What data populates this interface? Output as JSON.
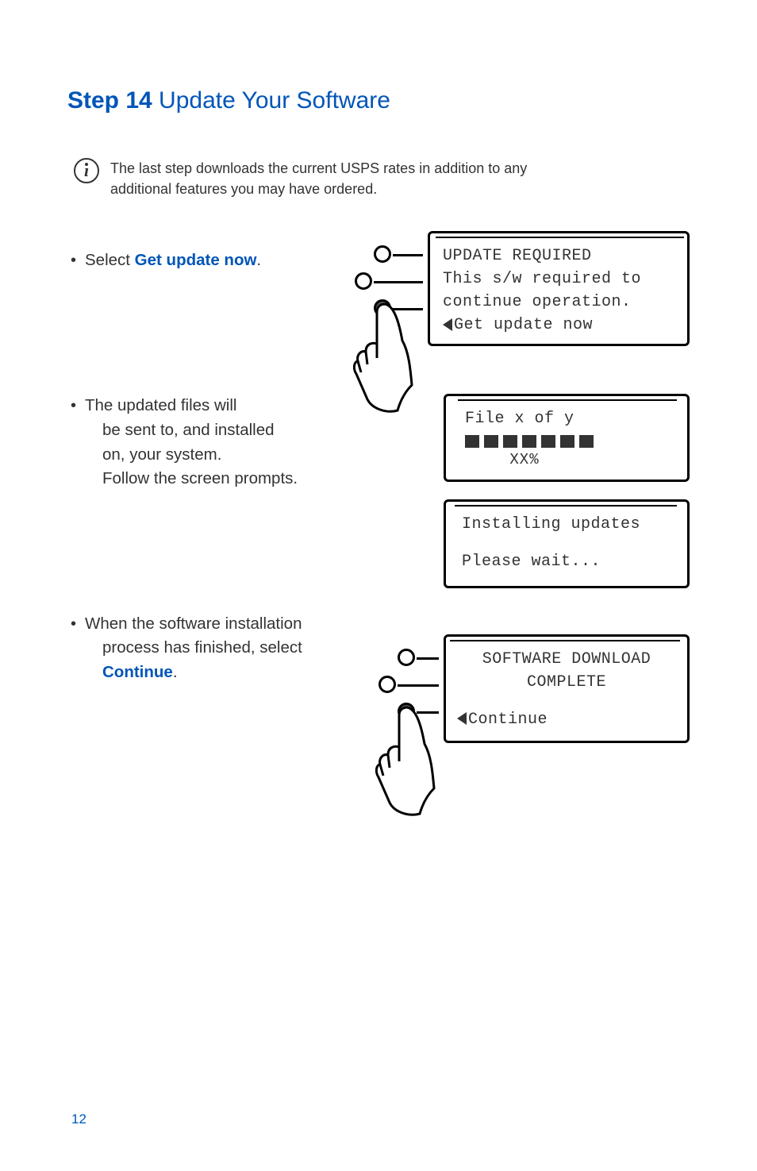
{
  "heading_bold": "Step 14",
  "heading_rest": " Update Your Software",
  "info_text_l1": "The last step downloads the current USPS rates in addition to any",
  "info_text_l2": "additional features you may have ordered.",
  "bullet1_prefix": "Select ",
  "bullet1_highlight": "Get update now",
  "bullet1_suffix": ".",
  "screen1_l1": "UPDATE REQUIRED",
  "screen1_l2": "This s/w required to",
  "screen1_l3": "continue operation.",
  "screen1_l4": "Get update now",
  "bullet2_l1": "The updated files will",
  "bullet2_l2": "be sent to, and installed",
  "bullet2_l3": "on, your system.",
  "bullet2_l4": "Follow the screen prompts.",
  "screen2_l1": "File x of y",
  "screen2_pct": "XX%",
  "screen3_l1": "Installing updates",
  "screen3_l2": "Please wait...",
  "bullet3_l1": "When the software installation",
  "bullet3_l2": "process has finished, select",
  "bullet3_highlight": "Continue",
  "bullet3_suffix": ".",
  "screen4_l1": "SOFTWARE DOWNLOAD",
  "screen4_l2": "COMPLETE",
  "screen4_l3": "Continue",
  "page_number": "12"
}
